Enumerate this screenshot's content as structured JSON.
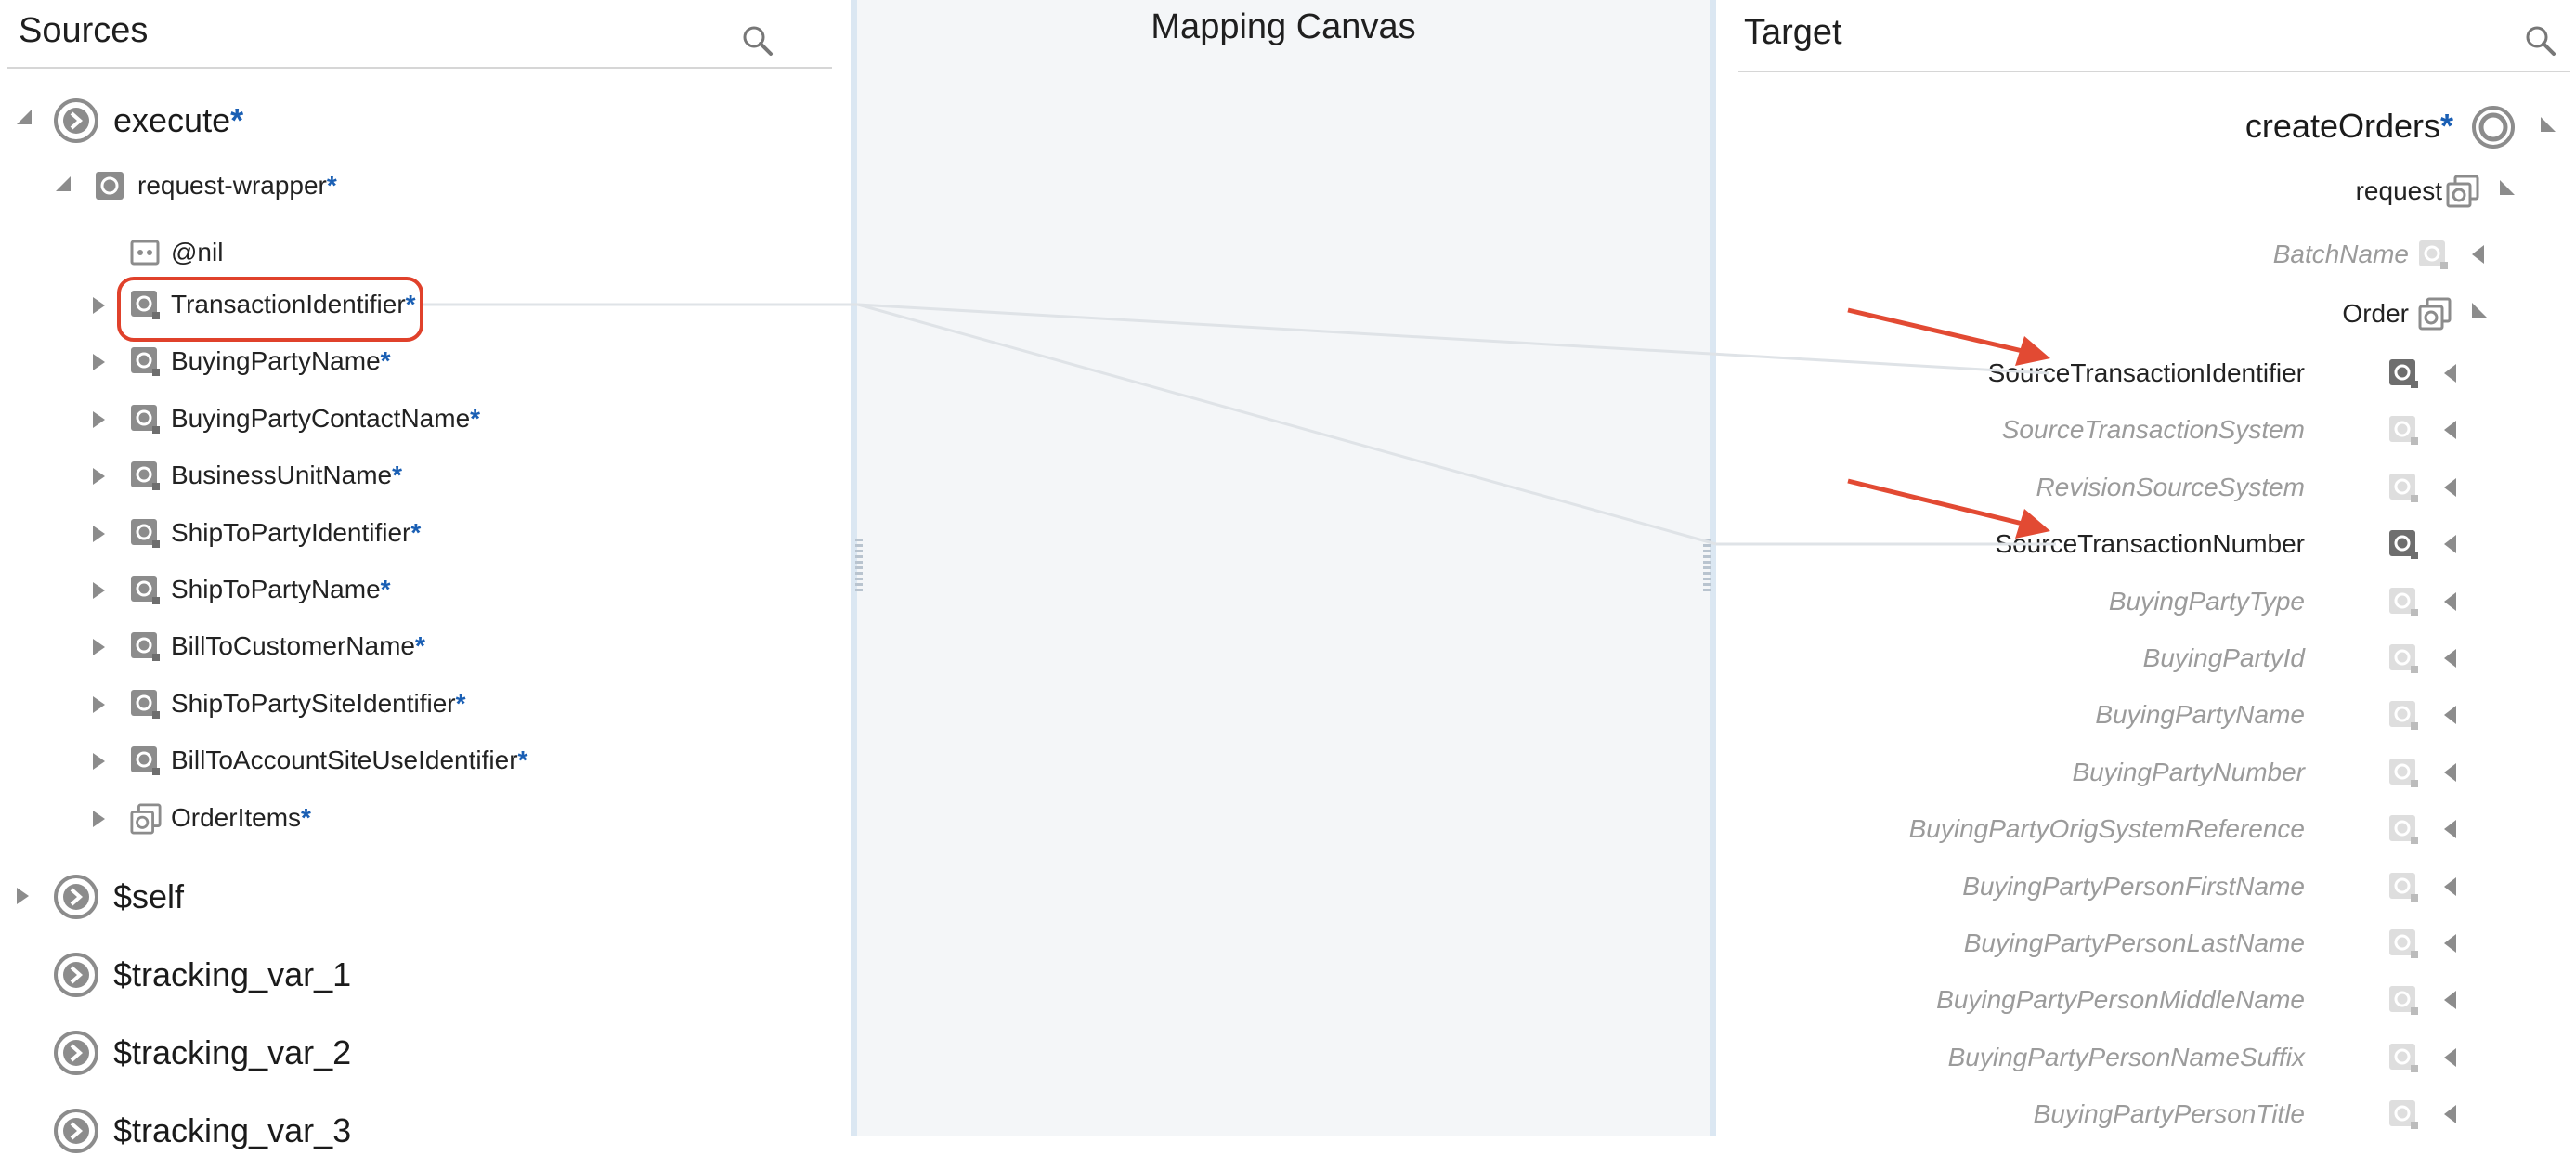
{
  "sources": {
    "title": "Sources",
    "execute": {
      "label": "execute",
      "required_marker": "*"
    },
    "request_wrapper": {
      "label": "request-wrapper",
      "required_marker": "*"
    },
    "nil": {
      "label": "@nil"
    },
    "items": [
      {
        "label": "TransactionIdentifier",
        "required_marker": "*",
        "highlighted": true
      },
      {
        "label": "BuyingPartyName",
        "required_marker": "*"
      },
      {
        "label": "BuyingPartyContactName",
        "required_marker": "*"
      },
      {
        "label": "BusinessUnitName",
        "required_marker": "*"
      },
      {
        "label": "ShipToPartyIdentifier",
        "required_marker": "*"
      },
      {
        "label": "ShipToPartyName",
        "required_marker": "*"
      },
      {
        "label": "BillToCustomerName",
        "required_marker": "*"
      },
      {
        "label": "ShipToPartySiteIdentifier",
        "required_marker": "*"
      },
      {
        "label": "BillToAccountSiteUseIdentifier",
        "required_marker": "*"
      },
      {
        "label": "OrderItems",
        "required_marker": "*",
        "icon": "collection-icon"
      }
    ],
    "variables": [
      {
        "label": "$self"
      },
      {
        "label": "$tracking_var_1"
      },
      {
        "label": "$tracking_var_2"
      },
      {
        "label": "$tracking_var_3"
      }
    ]
  },
  "canvas": {
    "title": "Mapping Canvas"
  },
  "target": {
    "title": "Target",
    "create_orders": {
      "label": "createOrders",
      "required_marker": "*"
    },
    "request": {
      "label": "request"
    },
    "batch_name": {
      "label": "BatchName"
    },
    "order": {
      "label": "Order"
    },
    "fields": [
      {
        "label": "SourceTransactionIdentifier",
        "mapped": true
      },
      {
        "label": "SourceTransactionSystem",
        "mapped": false
      },
      {
        "label": "RevisionSourceSystem",
        "mapped": false
      },
      {
        "label": "SourceTransactionNumber",
        "mapped": true
      },
      {
        "label": "BuyingPartyType",
        "mapped": false
      },
      {
        "label": "BuyingPartyId",
        "mapped": false
      },
      {
        "label": "BuyingPartyName",
        "mapped": false
      },
      {
        "label": "BuyingPartyNumber",
        "mapped": false
      },
      {
        "label": "BuyingPartyOrigSystemReference",
        "mapped": false
      },
      {
        "label": "BuyingPartyPersonFirstName",
        "mapped": false
      },
      {
        "label": "BuyingPartyPersonLastName",
        "mapped": false
      },
      {
        "label": "BuyingPartyPersonMiddleName",
        "mapped": false
      },
      {
        "label": "BuyingPartyPersonNameSuffix",
        "mapped": false
      },
      {
        "label": "BuyingPartyPersonTitle",
        "mapped": false
      }
    ]
  },
  "colors": {
    "required_marker": "#1a5fb4",
    "highlight_box": "#e0412b",
    "annotation_arrow": "#e24a33",
    "mapping_line": "#dfe3e7",
    "canvas_bg": "#f4f6f8"
  }
}
